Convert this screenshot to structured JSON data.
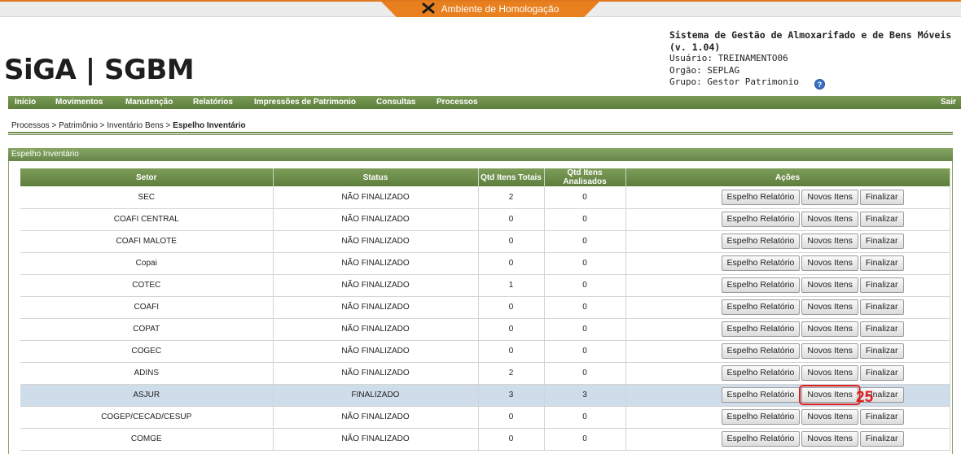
{
  "env_banner": "Ambiente de Homologação",
  "logo": {
    "part1": "SiGA",
    "separator": "|",
    "part2": "SGBM"
  },
  "sysinfo": {
    "title": "Sistema de Gestão de Almoxarifado e de Bens Móveis (v. 1.04)",
    "usuario": "Usuário: TREINAMENTO06",
    "orgao": "Orgão: SEPLAG",
    "grupo": "Grupo: Gestor Patrimonio"
  },
  "menu": {
    "inicio": "Início",
    "movimentos": "Movimentos",
    "manutencao": "Manutenção",
    "relatorios": "Relatórios",
    "impressoes": "Impressões de Patrimonio",
    "consultas": "Consultas",
    "processos": "Processos",
    "sair": "Sair"
  },
  "breadcrumb": {
    "path": "Processos > Patrimônio > Inventário Bens  > ",
    "current": "Espelho Inventário"
  },
  "panel_title": "Espelho Inventário",
  "table": {
    "headers": [
      "Setor",
      "Status",
      "Qtd Itens Totais",
      "Qtd Itens Analisados",
      "Ações"
    ],
    "actions": [
      "Espelho Relatório",
      "Novos Itens",
      "Finalizar"
    ],
    "rows": [
      {
        "setor": "SEC",
        "status": "NÃO FINALIZADO",
        "totais": "2",
        "analisados": "0"
      },
      {
        "setor": "COAFI CENTRAL",
        "status": "NÃO FINALIZADO",
        "totais": "0",
        "analisados": "0"
      },
      {
        "setor": "COAFI MALOTE",
        "status": "NÃO FINALIZADO",
        "totais": "0",
        "analisados": "0"
      },
      {
        "setor": "Copai",
        "status": "NÃO FINALIZADO",
        "totais": "0",
        "analisados": "0"
      },
      {
        "setor": "COTEC",
        "status": "NÃO FINALIZADO",
        "totais": "1",
        "analisados": "0"
      },
      {
        "setor": "COAFI",
        "status": "NÃO FINALIZADO",
        "totais": "0",
        "analisados": "0"
      },
      {
        "setor": "COPAT",
        "status": "NÃO FINALIZADO",
        "totais": "0",
        "analisados": "0"
      },
      {
        "setor": "COGEC",
        "status": "NÃO FINALIZADO",
        "totais": "0",
        "analisados": "0"
      },
      {
        "setor": "ADINS",
        "status": "NÃO FINALIZADO",
        "totais": "2",
        "analisados": "0"
      },
      {
        "setor": "ASJUR",
        "status": "FINALIZADO",
        "totais": "3",
        "analisados": "3"
      },
      {
        "setor": "COGEP/CECAD/CESUP",
        "status": "NÃO FINALIZADO",
        "totais": "0",
        "analisados": "0"
      },
      {
        "setor": "COMGE",
        "status": "NÃO FINALIZADO",
        "totais": "0",
        "analisados": "0"
      }
    ]
  },
  "annotation_marker": "25",
  "colors": {
    "banner": "#e8801f",
    "menu": "#6a8a48",
    "highlight_row": "#cfdcea",
    "marker": "#e02020"
  }
}
